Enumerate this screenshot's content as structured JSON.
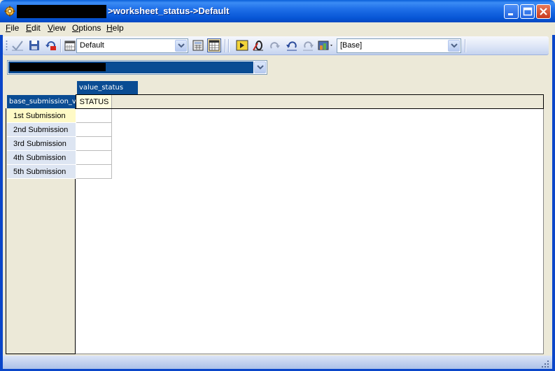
{
  "window": {
    "title": ">worksheet_status->Default"
  },
  "menu": {
    "items": [
      {
        "label": "File",
        "accel": "F",
        "rest": "ile"
      },
      {
        "label": "Edit",
        "accel": "E",
        "rest": "dit"
      },
      {
        "label": "View",
        "accel": "V",
        "rest": "iew"
      },
      {
        "label": "Options",
        "accel": "O",
        "rest": "ptions"
      },
      {
        "label": "Help",
        "accel": "H",
        "rest": "elp"
      }
    ]
  },
  "toolbar": {
    "layout_combo": "Default",
    "base_combo": "[Base]",
    "icons": [
      "validate-icon",
      "save-icon",
      "refresh-icon",
      "calendar-icon",
      "calculator-icon",
      "grid-icon",
      "run-icon",
      "zero-suppress-icon",
      "redo-icon",
      "undo-icon",
      "forward-icon",
      "image-dropdown-icon"
    ]
  },
  "grid": {
    "column_dimension": "value_status",
    "row_dimension": "base_submission_v",
    "column_header": "STATUS",
    "rows": [
      "1st Submission",
      "2nd Submission",
      "3rd Submission",
      "4th Submission",
      "5th Submission"
    ],
    "selected_row": 0
  },
  "colors": {
    "dimension_header": "#0a4c93",
    "selected_row": "#fffac6",
    "row_label_bg": "#dde5f2",
    "titlebar": "#0756d6"
  }
}
